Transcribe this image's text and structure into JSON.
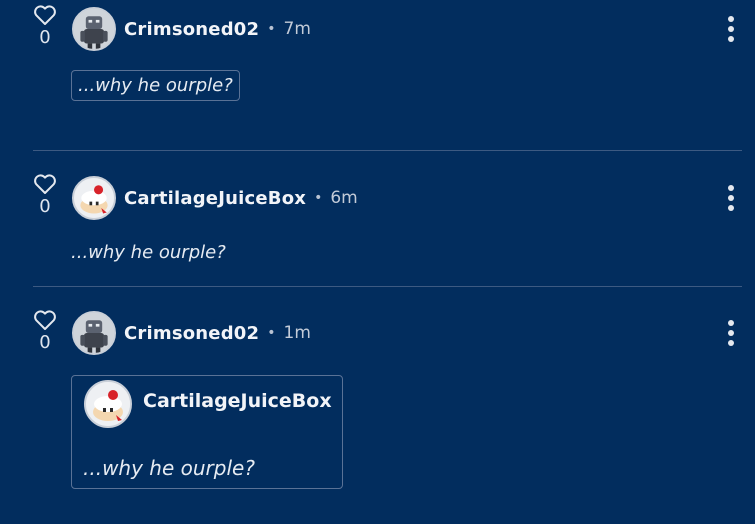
{
  "colors": {
    "background": "#022d5e",
    "divider": "#3d5a82",
    "text": "#eef1f6"
  },
  "posts": [
    {
      "likes": "0",
      "username": "Crimsoned02",
      "separator": "•",
      "time": "7m",
      "text": "...why he ourple?",
      "avatar_icon": "robot-character-avatar",
      "heart_icon": "heart-outline-icon",
      "menu_icon": "more-vertical-icon"
    },
    {
      "likes": "0",
      "username": "CartilageJuiceBox",
      "separator": "•",
      "time": "6m",
      "text": "...why he ourple?",
      "avatar_icon": "cake-character-avatar",
      "heart_icon": "heart-outline-icon",
      "menu_icon": "more-vertical-icon"
    },
    {
      "likes": "0",
      "username": "Crimsoned02",
      "separator": "•",
      "time": "1m",
      "avatar_icon": "robot-character-avatar",
      "heart_icon": "heart-outline-icon",
      "menu_icon": "more-vertical-icon",
      "quote": {
        "username": "CartilageJuiceBox",
        "text": "...why he ourple?",
        "avatar_icon": "cake-character-avatar"
      }
    }
  ]
}
